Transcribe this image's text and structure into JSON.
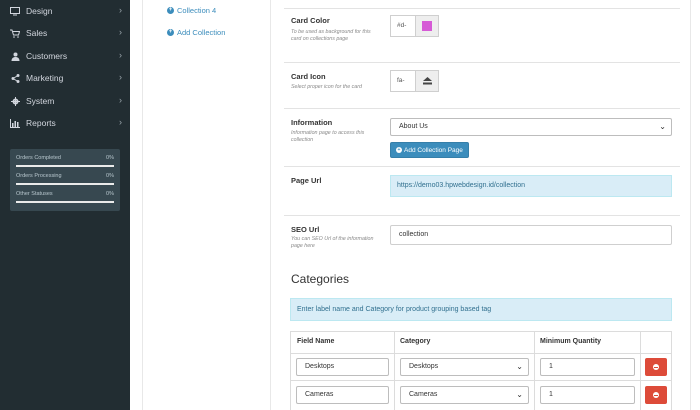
{
  "sidebar": {
    "items": [
      {
        "label": "Design",
        "icon": "monitor-icon"
      },
      {
        "label": "Sales",
        "icon": "cart-icon"
      },
      {
        "label": "Customers",
        "icon": "user-icon"
      },
      {
        "label": "Marketing",
        "icon": "share-icon"
      },
      {
        "label": "System",
        "icon": "gear-icon"
      },
      {
        "label": "Reports",
        "icon": "bar-chart-icon"
      }
    ],
    "stats": [
      {
        "label": "Orders Completed",
        "value": "0%"
      },
      {
        "label": "Orders Processing",
        "value": "0%"
      },
      {
        "label": "Other Statuses",
        "value": "0%"
      }
    ]
  },
  "collections": {
    "current": "Collection 4",
    "add_label": "Add Collection"
  },
  "form": {
    "card_color": {
      "label": "Card Color",
      "help": "To be used as background for this card on collections page",
      "value": "#d-",
      "swatch": "#d65ad6"
    },
    "card_icon": {
      "label": "Card Icon",
      "help": "Select proper icon for the card",
      "value": "fa-"
    },
    "information": {
      "label": "Information",
      "help": "Information page to access this collection",
      "selected": "About Us",
      "add_button": "Add Collection Page"
    },
    "page_url": {
      "label": "Page Url",
      "value": "https://demo03.hpwebdesign.id/collection"
    },
    "seo_url": {
      "label": "SEO Url",
      "help": "You can SEO Url of the information page here",
      "value": "collection"
    }
  },
  "categories": {
    "title": "Categories",
    "info": "Enter label name and Category for product grouping based tag",
    "columns": [
      "Field Name",
      "Category",
      "Minimum Quantity"
    ],
    "rows": [
      {
        "field": "Desktops",
        "category": "Desktops",
        "min_qty": "1"
      },
      {
        "field": "Cameras",
        "category": "Cameras",
        "min_qty": "1"
      }
    ]
  }
}
